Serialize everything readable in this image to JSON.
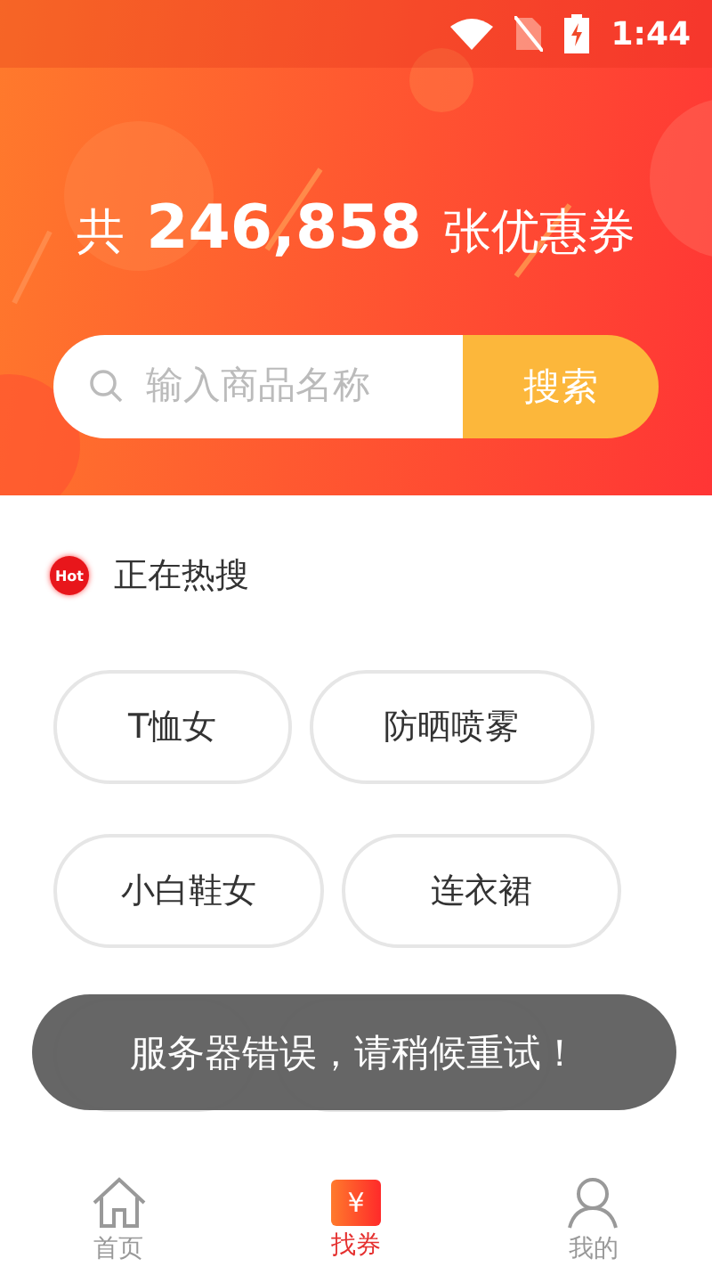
{
  "status_bar": {
    "time": "1:44"
  },
  "header": {
    "prefix": "共",
    "count": "246,858",
    "suffix": "张优惠券"
  },
  "search": {
    "placeholder": "输入商品名称",
    "button": "搜索"
  },
  "hot": {
    "badge": "Hot",
    "title": "正在热搜"
  },
  "tags": [
    {
      "label": "T恤女"
    },
    {
      "label": "防晒喷雾"
    },
    {
      "label": "小白鞋女"
    },
    {
      "label": "连衣裙"
    },
    {
      "covered": true
    },
    {
      "covered": true
    }
  ],
  "toast": "服务器错误，请稍候重试！",
  "nav": [
    {
      "label": "首页",
      "kind": "home",
      "selected": false
    },
    {
      "label": "找券",
      "kind": "coupon",
      "icon_text": "¥",
      "selected": true
    },
    {
      "label": "我的",
      "kind": "profile",
      "selected": false
    }
  ]
}
